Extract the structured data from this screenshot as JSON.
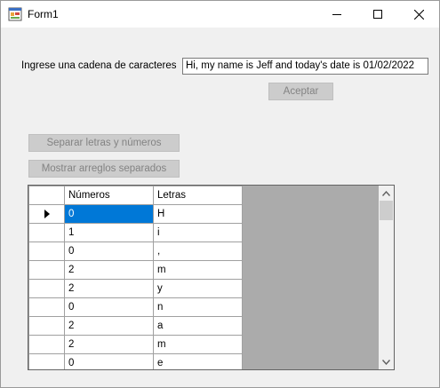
{
  "window": {
    "title": "Form1"
  },
  "form": {
    "label": "Ingrese una cadena de caracteres",
    "input_value": "Hi, my name is Jeff and today's date is 01/02/2022",
    "aceptar_label": "Aceptar",
    "separar_label": "Separar letras y números",
    "mostrar_label": "Mostrar arreglos separados"
  },
  "grid": {
    "columns": [
      "Números",
      "Letras"
    ],
    "rows": [
      [
        "0",
        "H"
      ],
      [
        "1",
        "i"
      ],
      [
        "0",
        ","
      ],
      [
        "2",
        "m"
      ],
      [
        "2",
        "y"
      ],
      [
        "0",
        "n"
      ],
      [
        "2",
        "a"
      ],
      [
        "2",
        "m"
      ],
      [
        "0",
        "e"
      ]
    ],
    "selected_row": 0,
    "colors": {
      "selection": "#0078d7",
      "background": "#ababab"
    }
  }
}
